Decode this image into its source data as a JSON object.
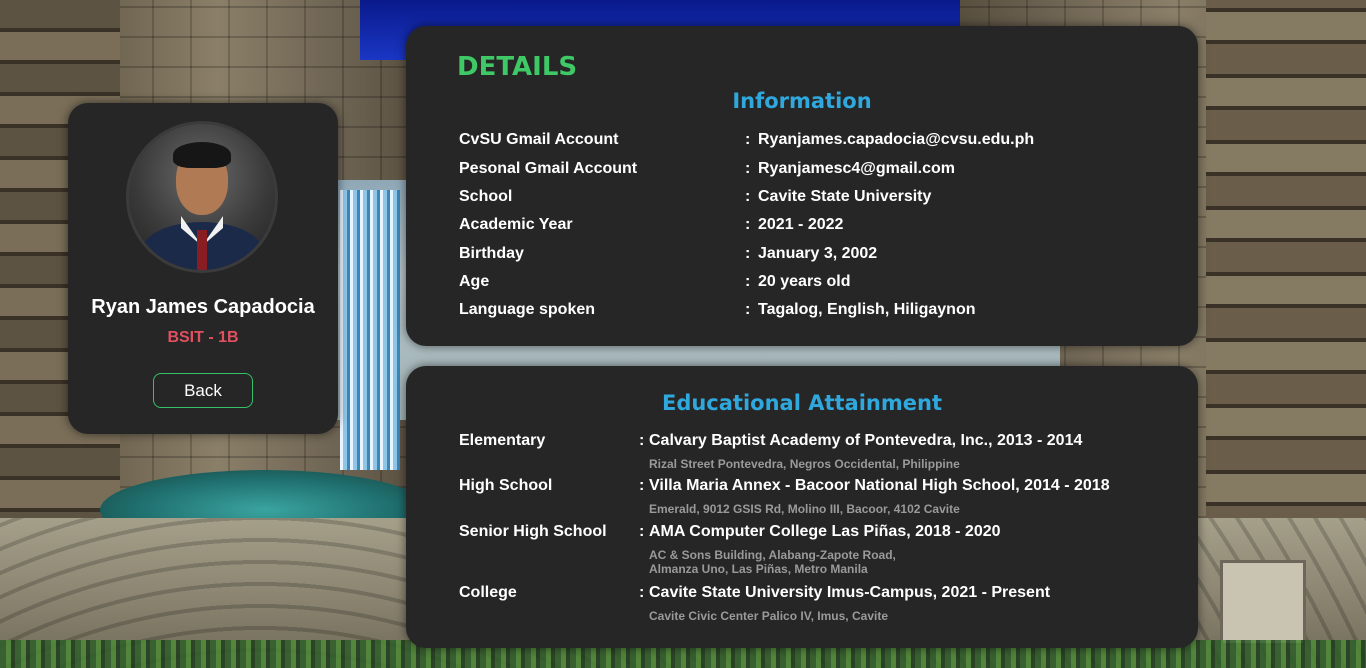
{
  "profile": {
    "name": "Ryan James Capadocia",
    "section": "BSIT - 1B",
    "back_label": "Back",
    "avatar_icon": "profile-photo"
  },
  "details": {
    "title": "DETAILS",
    "info_title": "Information",
    "rows": [
      {
        "label": "CvSU Gmail Account",
        "value": "Ryanjames.capadocia@cvsu.edu.ph"
      },
      {
        "label": "Pesonal Gmail Account",
        "value": "Ryanjamesc4@gmail.com"
      },
      {
        "label": "School",
        "value": "Cavite State University"
      },
      {
        "label": "Academic Year",
        "value": "2021 - 2022"
      },
      {
        "label": "Birthday",
        "value": "January 3, 2002"
      },
      {
        "label": "Age",
        "value": "20 years old"
      },
      {
        "label": "Language spoken",
        "value": "Tagalog, English, Hiligaynon"
      }
    ]
  },
  "education": {
    "title": "Educational Attainment",
    "rows": [
      {
        "label": "Elementary",
        "value": "Calvary Baptist Academy of Pontevedra, Inc., 2013 - 2014",
        "address": "Rizal Street Pontevedra, Negros Occidental, Philippine"
      },
      {
        "label": "High School",
        "value": "Villa Maria Annex - Bacoor National High School, 2014 - 2018",
        "address": "Emerald, 9012 GSIS Rd, Molino III, Bacoor, 4102 Cavite"
      },
      {
        "label": "Senior High School",
        "value": "AMA Computer College Las Piñas, 2018 - 2020",
        "address_line1": "AC & Sons Building, Alabang-Zapote Road,",
        "address_line2": "Almanza Uno, Las Piñas, Metro Manila"
      },
      {
        "label": "College",
        "value": "Cavite State University Imus-Campus, 2021 - Present",
        "address": "Cavite Civic Center Palico IV, Imus, Cavite"
      }
    ]
  },
  "colors": {
    "card_bg": "#262626",
    "details_title": "#3fc866",
    "section_title": "#2fa8dd",
    "section_badge": "#e0505e",
    "button_border": "#37c06a",
    "address_text": "#9a9a9a"
  }
}
